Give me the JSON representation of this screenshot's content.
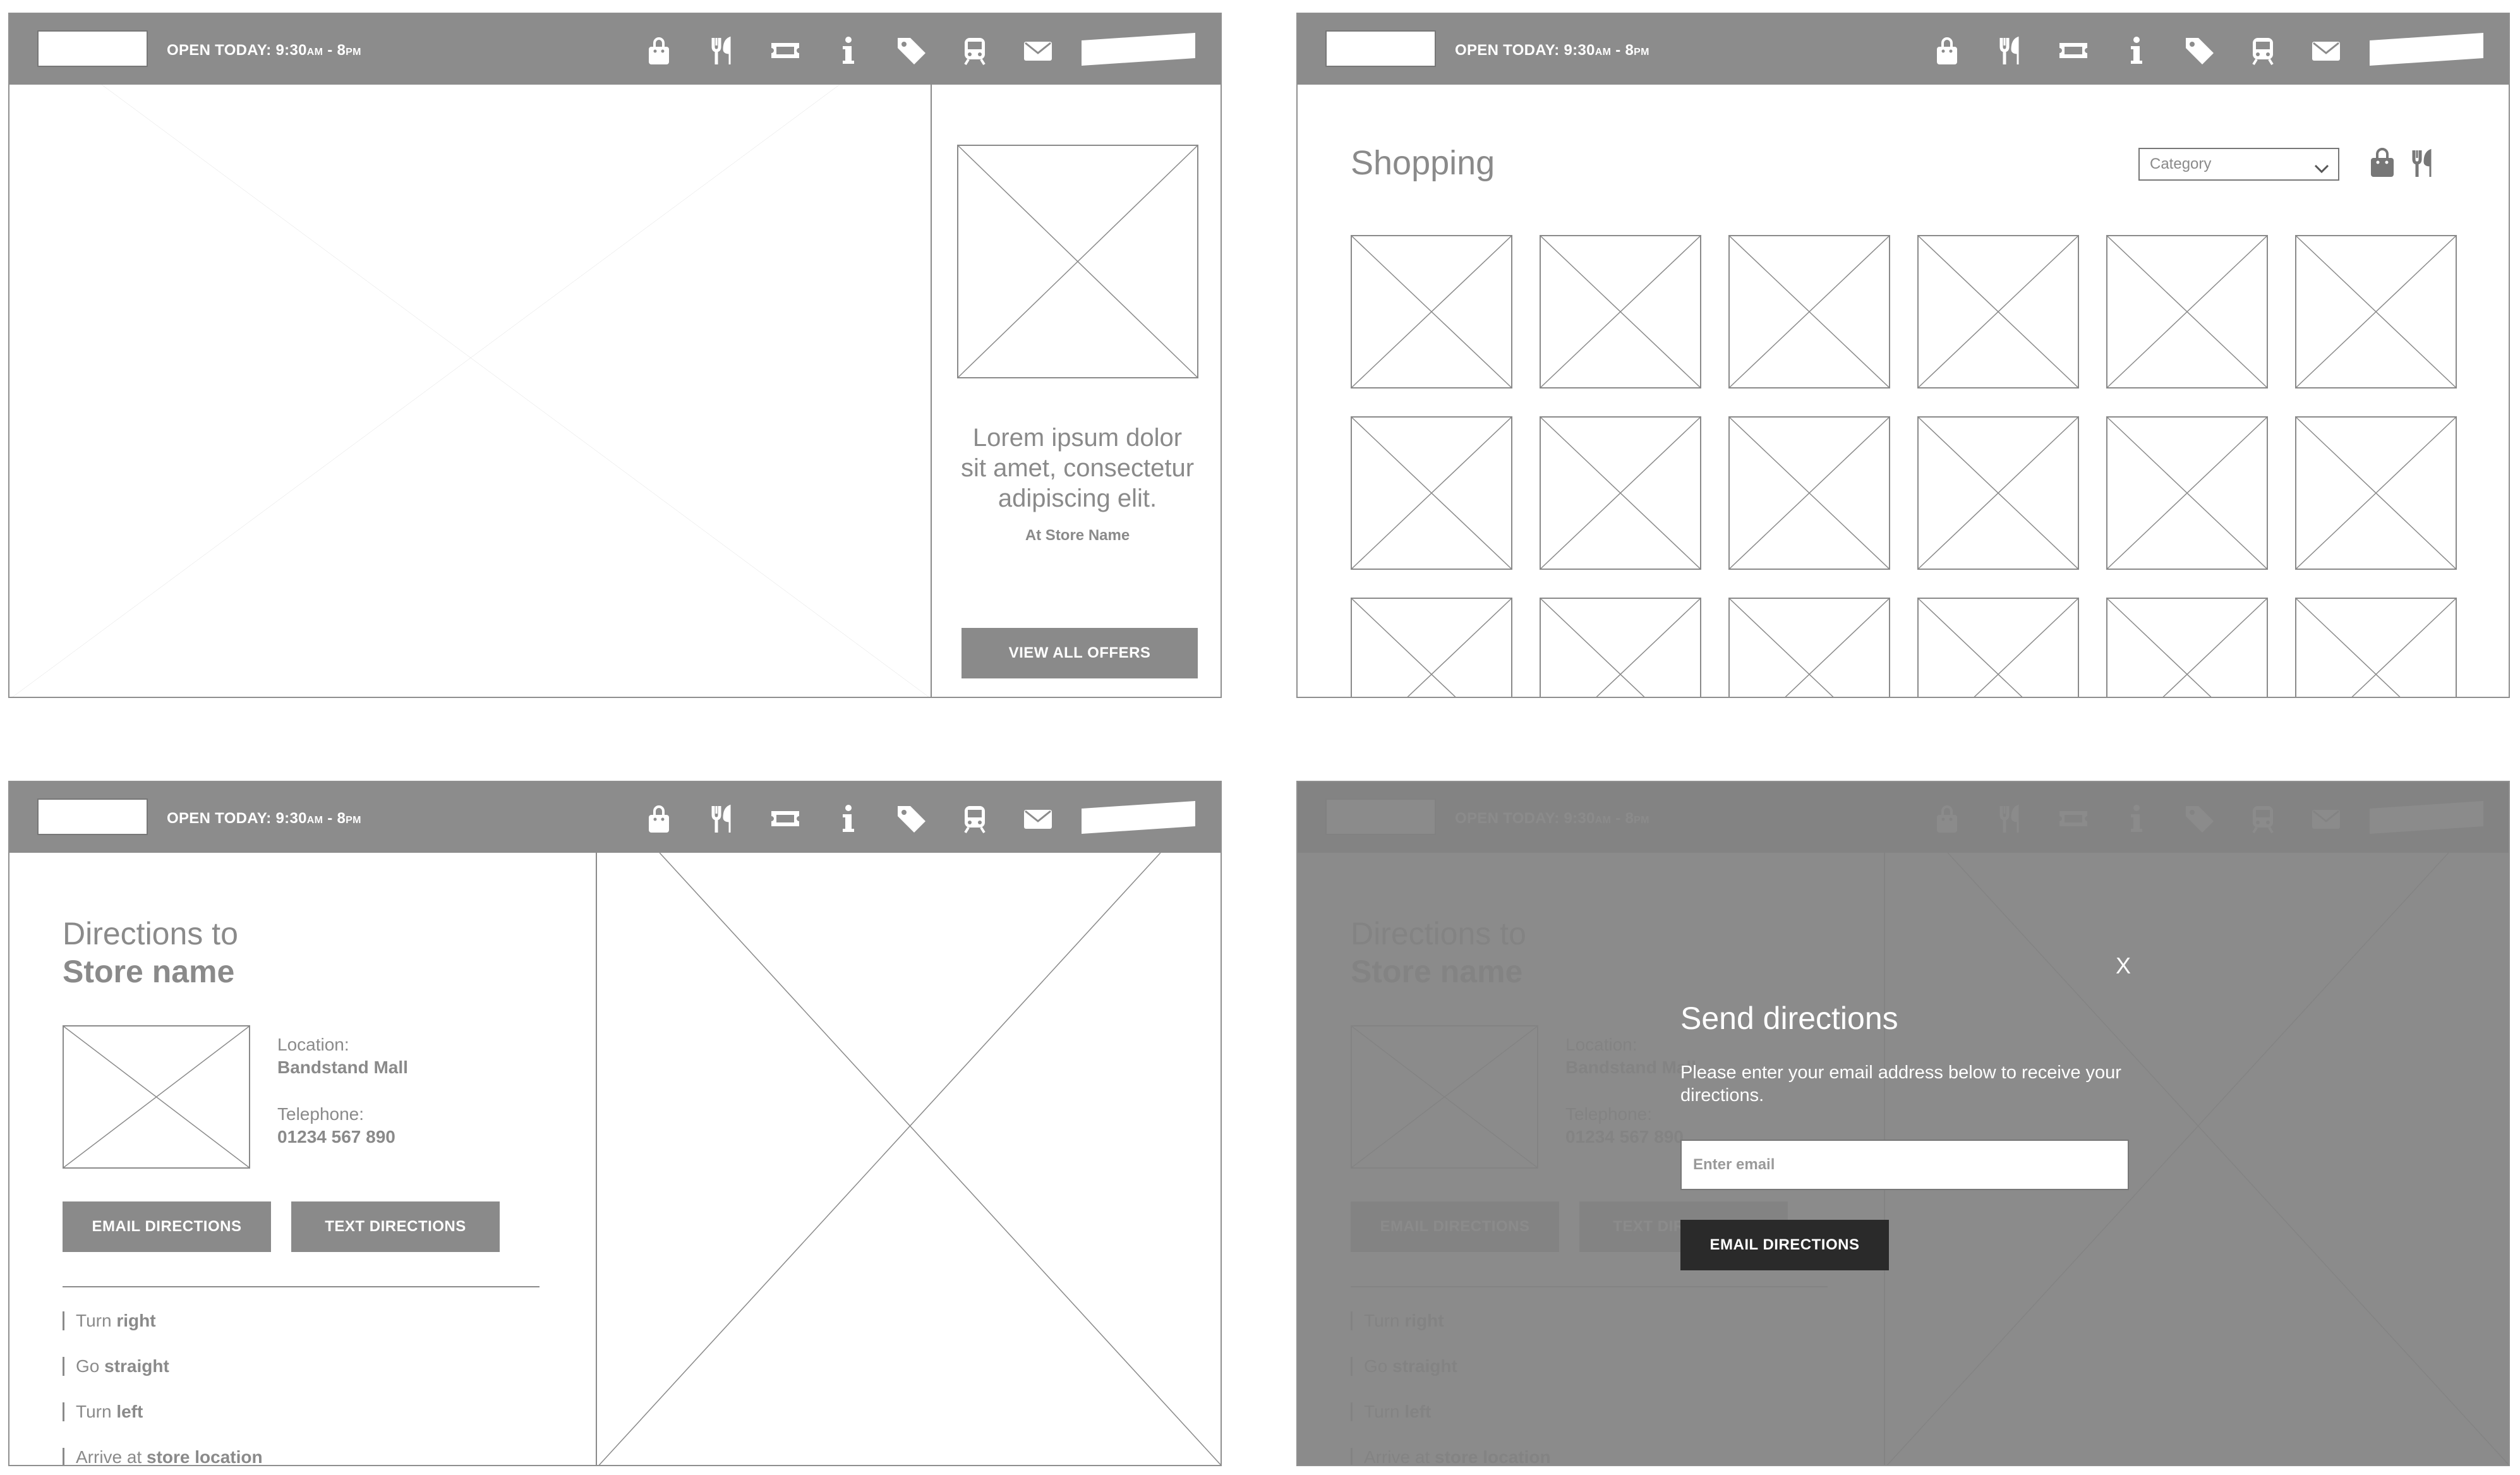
{
  "header": {
    "hours": "OPEN TODAY: 9:30AM - 8PM",
    "nav_icons": [
      "shopping-bag-icon",
      "fork-knife-icon",
      "ticket-icon",
      "info-icon",
      "tag-icon",
      "train-icon",
      "mail-icon"
    ]
  },
  "offers": {
    "text": "Lorem ipsum dolor sit amet, consectetur adipiscing elit.",
    "store": "At Store Name",
    "button": "VIEW ALL OFFERS"
  },
  "shopping": {
    "title": "Shopping",
    "category_placeholder": "Category"
  },
  "directions": {
    "title_line1": "Directions to",
    "title_line2": "Store name",
    "location_label": "Location:",
    "location_value": "Bandstand Mall",
    "telephone_label": "Telephone:",
    "telephone_value": "01234 567 890",
    "email_button": "EMAIL DIRECTIONS",
    "text_button": "TEXT DIRECTIONS",
    "steps": [
      {
        "prefix": "Turn",
        "bold": "right"
      },
      {
        "prefix": "Go",
        "bold": "straight"
      },
      {
        "prefix": "Turn",
        "bold": "left"
      },
      {
        "prefix": "Arrive at",
        "bold": "store location"
      }
    ]
  },
  "modal": {
    "close": "X",
    "title": "Send directions",
    "text": "Please enter your email address below to receive your directions.",
    "placeholder": "Enter email",
    "button": "EMAIL DIRECTIONS"
  },
  "colors": {
    "bar": "#8c8c8c",
    "line": "#8a8a8a",
    "dark_button": "#2a2a2a"
  }
}
